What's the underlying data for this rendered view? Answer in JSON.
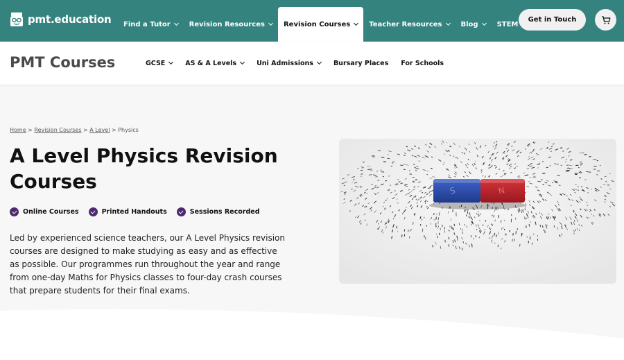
{
  "header": {
    "logo_text": "pmt.education",
    "nav": [
      {
        "label": "Find a Tutor",
        "active": false
      },
      {
        "label": "Revision Resources",
        "active": false
      },
      {
        "label": "Revision Courses",
        "active": true
      },
      {
        "label": "Teacher Resources",
        "active": false
      },
      {
        "label": "Blog",
        "active": false
      },
      {
        "label": "STEM",
        "active": false
      }
    ],
    "cta_label": "Get in Touch",
    "cart_icon": "cart-icon"
  },
  "subheader": {
    "title": "PMT Courses",
    "nav": [
      {
        "label": "GCSE"
      },
      {
        "label": "AS & A Levels"
      },
      {
        "label": "Uni Admissions"
      },
      {
        "label": "Bursary Places"
      },
      {
        "label": "For Schools"
      }
    ]
  },
  "breadcrumb": {
    "items": [
      "Home",
      "Revision Courses",
      "A Level"
    ],
    "current": "Physics",
    "separator": ">"
  },
  "hero": {
    "title": "A Level Physics Revision Courses",
    "features": [
      "Online Courses",
      "Printed Handouts",
      "Sessions Recorded"
    ],
    "description": "Led by experienced science teachers, our A Level Physics revision courses are designed to make studying as easy and as effective as possible. Our programmes run throughout the year and range from one-day Maths for Physics classes to four-day crash courses that prepare students for their final exams."
  },
  "colors": {
    "brand_teal": "#35837f",
    "check_purple": "#4b2a6e",
    "magnet_red": "#c8232c",
    "magnet_blue": "#2c4fb3"
  }
}
